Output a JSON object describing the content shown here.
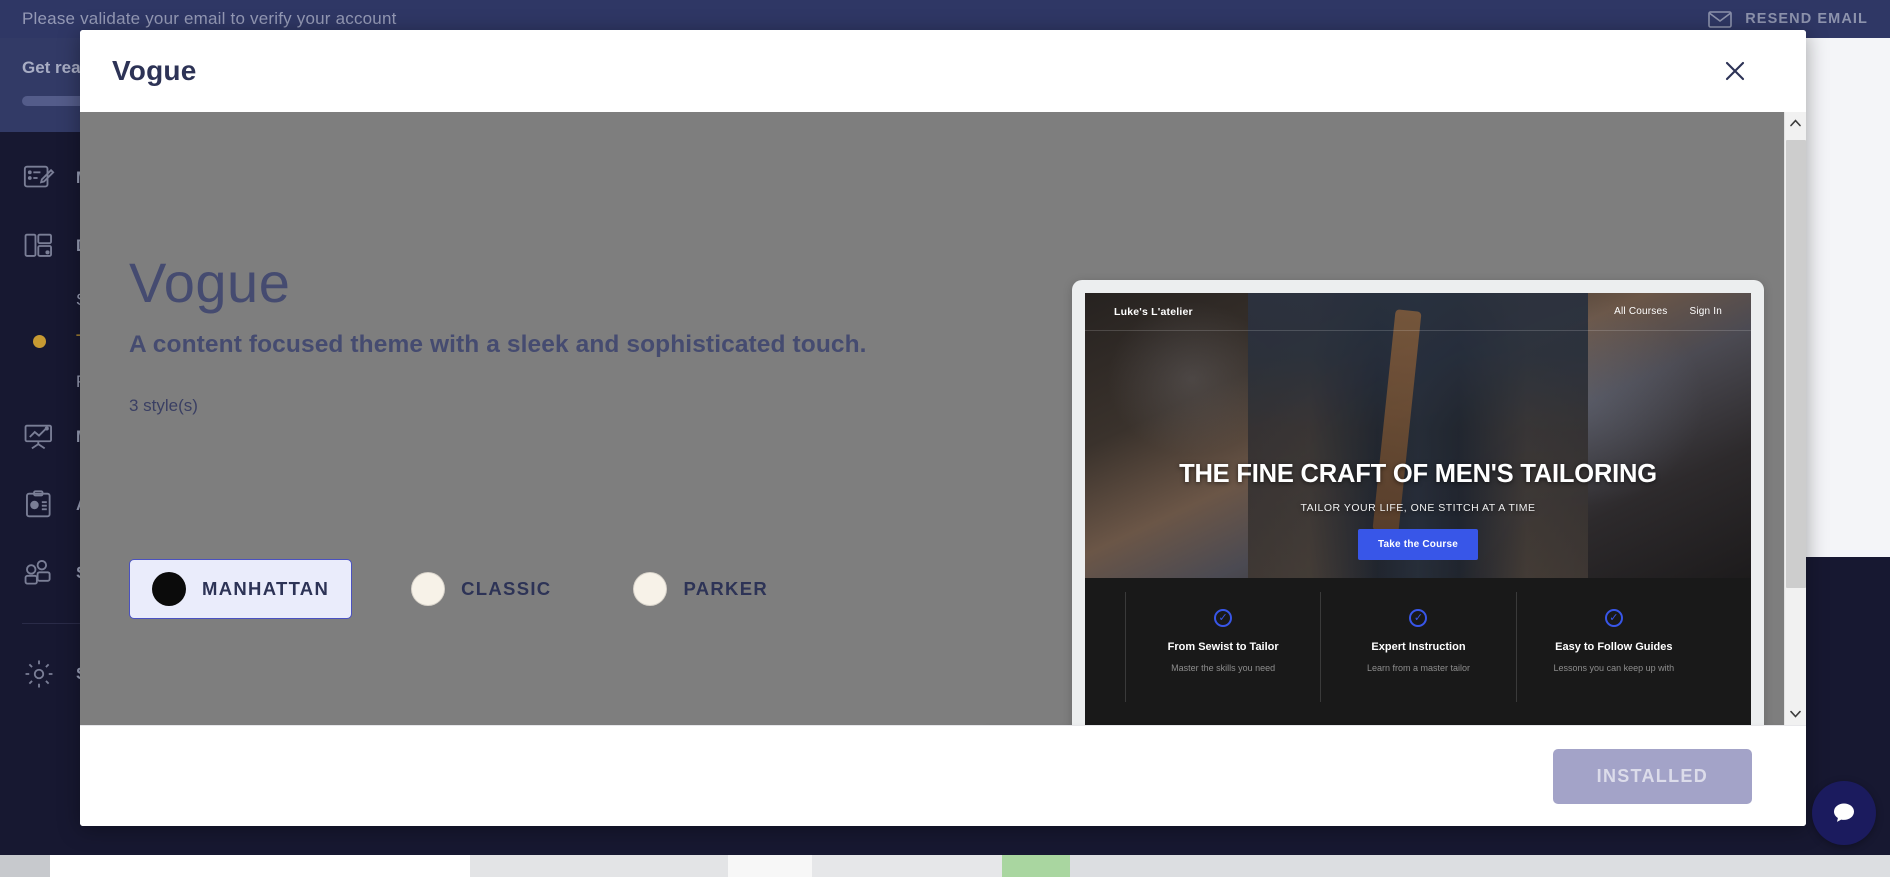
{
  "notice_bar": {
    "message": "Please validate your email to verify your account",
    "resend_label": "RESEND EMAIL",
    "icon": "envelope-icon",
    "bg_color": "#2f3765",
    "text_color": "#9499b5"
  },
  "sidebar": {
    "getready": {
      "title": "Get ready",
      "progress_pct": 40
    },
    "items": [
      {
        "label": "MANAGE CONTENT",
        "icon": "edit-note-icon",
        "type": "section"
      },
      {
        "label": "DESIGN",
        "icon": "layout-icon",
        "type": "section"
      },
      {
        "label": "Site",
        "type": "sub",
        "active": false
      },
      {
        "label": "Themes",
        "type": "sub",
        "active": true
      },
      {
        "label": "Pages",
        "type": "sub",
        "active": false
      },
      {
        "label": "MARKET",
        "icon": "chart-board-icon",
        "type": "section"
      },
      {
        "label": "ADMIN",
        "icon": "clipboard-chart-icon",
        "type": "section"
      },
      {
        "label": "SUPPORT",
        "icon": "users-icon",
        "type": "section"
      },
      {
        "label": "SETTINGS",
        "icon": "gear-icon",
        "type": "section"
      }
    ],
    "bg_color": "#171831",
    "active_color": "#c79a32"
  },
  "modal": {
    "header_title": "Vogue",
    "close_icon": "close-icon",
    "theme": {
      "name": "Vogue",
      "tagline": "A content focused theme with a sleek and sophisticated touch.",
      "style_count_label": "3 style(s)",
      "styles": [
        {
          "label": "MANHATTAN",
          "swatch_color": "#0b0b0b",
          "selected": true
        },
        {
          "label": "CLASSIC",
          "swatch_color": "#f7f2e8",
          "selected": false
        },
        {
          "label": "PARKER",
          "swatch_color": "#f7f2e8",
          "selected": false
        }
      ],
      "selected_style": "MANHATTAN",
      "selected_border_color": "#4a51c0",
      "selected_bg_color": "#eaecfb"
    },
    "preview": {
      "device": "laptop",
      "site": {
        "brand": "Luke's L'atelier",
        "nav_links": [
          "All Courses",
          "Sign In"
        ],
        "hero_heading": "THE FINE CRAFT OF MEN'S TAILORING",
        "hero_subheading": "TAILOR YOUR LIFE, ONE STITCH AT A TIME",
        "hero_cta_label": "Take the Course",
        "hero_cta_color": "#3856e8",
        "features": [
          {
            "icon": "check-circle-icon",
            "title": "From Sewist to Tailor",
            "body": "Master the skills you need"
          },
          {
            "icon": "check-circle-icon",
            "title": "Expert Instruction",
            "body": "Learn from a master tailor"
          },
          {
            "icon": "check-circle-icon",
            "title": "Easy to Follow Guides",
            "body": "Lessons you can keep up with"
          }
        ]
      }
    },
    "scrollbar": {
      "up_arrow": "chevron-up-icon",
      "down_arrow": "chevron-down-icon"
    },
    "footer": {
      "primary_button_label": "INSTALLED",
      "primary_button_disabled": true,
      "primary_button_color": "#a3a3c8"
    }
  },
  "chat_widget": {
    "icon": "chat-bubble-icon",
    "color": "#1b1b5e"
  }
}
